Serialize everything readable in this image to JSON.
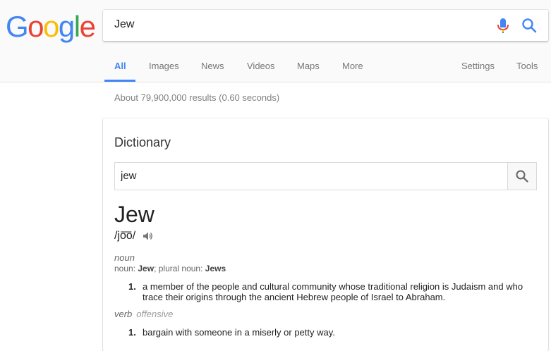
{
  "logo": {
    "letters": [
      "G",
      "o",
      "o",
      "g",
      "l",
      "e"
    ],
    "colors": [
      "#4285f4",
      "#ea4335",
      "#fbbc05",
      "#4285f4",
      "#34a853",
      "#ea4335"
    ]
  },
  "search": {
    "query": "Jew"
  },
  "tabs": {
    "all": "All",
    "images": "Images",
    "news": "News",
    "videos": "Videos",
    "maps": "Maps",
    "more": "More",
    "settings": "Settings",
    "tools": "Tools"
  },
  "stats": "About 79,900,000 results (0.60 seconds)",
  "dictionary": {
    "title": "Dictionary",
    "search_value": "jew",
    "headword": "Jew",
    "phonetic": "/jo͞o/",
    "noun": {
      "pos": "noun",
      "forms_prefix": "noun: ",
      "forms_word": "Jew",
      "forms_mid": "; plural noun: ",
      "forms_plural": "Jews",
      "def_num": "1.",
      "definition": "a member of the people and cultural community whose traditional religion is Judaism and who trace their origins through the ancient Hebrew people of Israel to Abraham."
    },
    "verb": {
      "pos": "verb",
      "label": "offensive",
      "def_num": "1.",
      "definition": "bargain with someone in a miserly or petty way."
    }
  },
  "icons": {
    "mic": "microphone-icon",
    "search": "search-icon",
    "speaker": "speaker-icon"
  }
}
